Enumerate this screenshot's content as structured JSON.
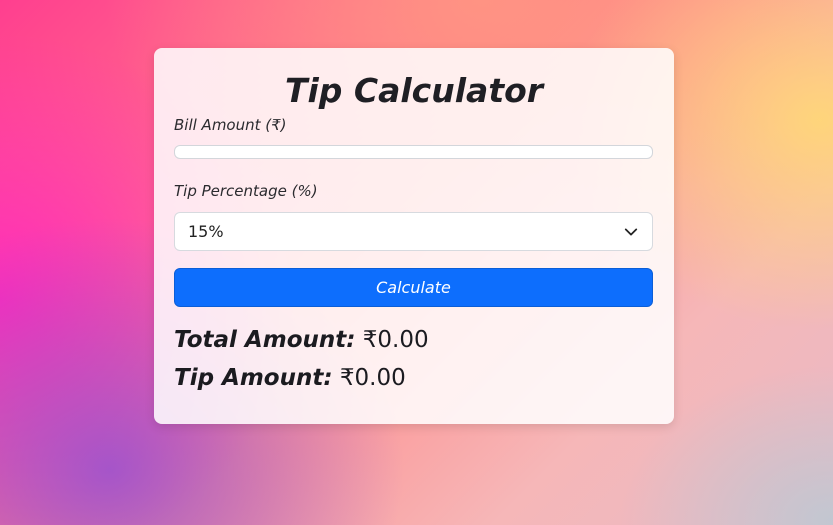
{
  "card": {
    "title": "Tip Calculator",
    "bill": {
      "label": "Bill Amount (₹)",
      "value": "",
      "placeholder": ""
    },
    "tip": {
      "label": "Tip Percentage (%)",
      "selected": "15%"
    },
    "button": {
      "label": "Calculate"
    },
    "results": {
      "total_label": "Total Amount:",
      "total_value": " ₹0.00",
      "tip_label": "Tip Amount:",
      "tip_value": " ₹0.00"
    }
  },
  "icons": {
    "select_arrow": "chevron-down-icon"
  },
  "colors": {
    "button_bg": "#0d6efd",
    "button_text": "#ffffff",
    "card_bg": "rgba(255,255,255,0.86)"
  }
}
